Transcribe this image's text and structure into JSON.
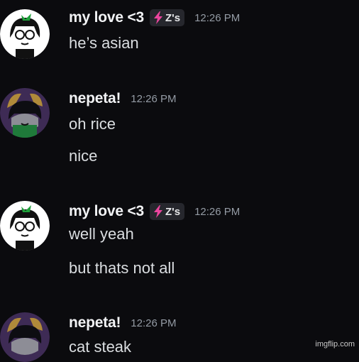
{
  "messages": [
    {
      "username": "my love <3",
      "tag": "Z's",
      "timestamp": "12:26 PM",
      "lines": [
        "he’s asian"
      ]
    },
    {
      "username": "nepeta!",
      "timestamp": "12:26 PM",
      "lines": [
        "oh rice",
        "nice"
      ]
    },
    {
      "username": "my love <3",
      "tag": "Z's",
      "timestamp": "12:26 PM",
      "lines": [
        "well yeah",
        "but thats not all"
      ]
    },
    {
      "username": "nepeta!",
      "timestamp": "12:26 PM",
      "lines": [
        "cat steak"
      ]
    }
  ],
  "watermark": "imgflip.com",
  "colors": {
    "background": "#0b0b0e",
    "username": "#f2f3f5",
    "timestamp": "#949ba4",
    "tag_bg": "#26272d",
    "tag_bolt": "#eb459e"
  }
}
